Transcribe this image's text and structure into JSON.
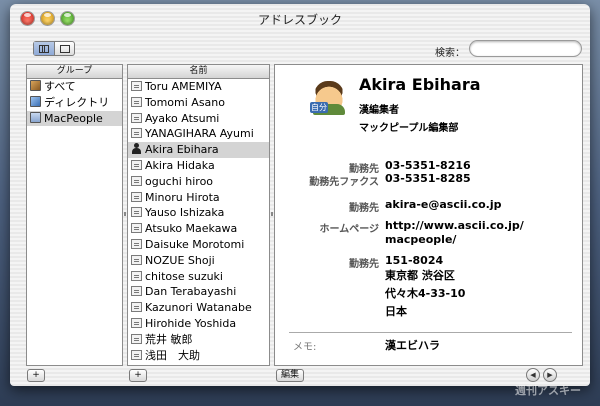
{
  "window": {
    "title": "アドレスブック"
  },
  "toolbar": {
    "search_label": "検索：",
    "search_value": "",
    "search_placeholder": ""
  },
  "groups": {
    "header": "グループ",
    "items": [
      {
        "label": "すべて",
        "icon": "all-contacts-icon"
      },
      {
        "label": "ディレクトリ",
        "icon": "directory-icon"
      },
      {
        "label": "MacPeople",
        "icon": "group-folder-icon",
        "selected": true
      }
    ]
  },
  "names": {
    "header": "名前",
    "items": [
      "Toru AMEMIYA",
      "Tomomi Asano",
      "Ayako Atsumi",
      "YANAGIHARA Ayumi",
      "Akira Ebihara",
      "Akira Hidaka",
      "oguchi hiroo",
      "Minoru Hirota",
      "Yauso Ishizaka",
      "Atsuko Maekawa",
      "Daisuke Morotomi",
      "NOZUE Shoji",
      "chitose suzuki",
      "Dan Terabayashi",
      "Kazunori Watanabe",
      "Hirohide Yoshida",
      "荒井 敏郎",
      "浅田　大助"
    ],
    "selected_index": 4
  },
  "card": {
    "avatar_tag": "自分",
    "name": "Akira Ebihara",
    "title": "漢編集者",
    "company": "マックピープル編集部",
    "phone_work_label": "勤務先",
    "phone_work": "03-5351-8216",
    "fax_label": "勤務先ファクス",
    "fax": "03-5351-8285",
    "email_label": "勤務先",
    "email": "akira-e@ascii.co.jp",
    "homepage_label": "ホームページ",
    "homepage_line1": "http://www.ascii.co.jp/",
    "homepage_line2": "macpeople/",
    "address_label": "勤務先",
    "postal": "151-8024",
    "address1": "東京都 渋谷区",
    "address2": "代々木4-33-10",
    "country": "日本",
    "memo_label": "メモ:",
    "memo": "漢エビハラ"
  },
  "bottom": {
    "add_group": "+",
    "add_person": "+",
    "edit": "編集",
    "prev": "◀",
    "next": "▶"
  },
  "watermark": "週刊アスキー",
  "colors": {
    "selection": "#d4d4d4",
    "search_bg": "#ffffff"
  }
}
